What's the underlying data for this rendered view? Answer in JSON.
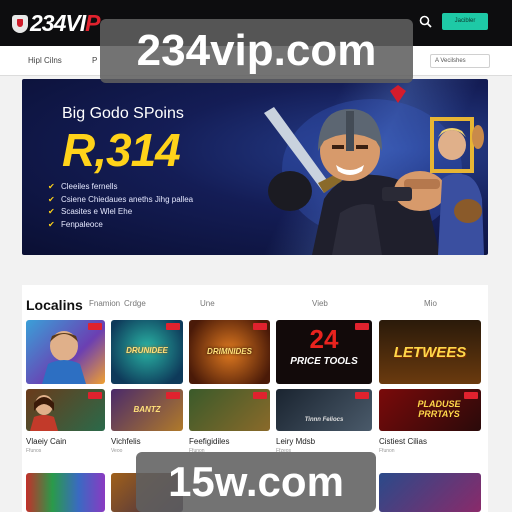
{
  "header": {
    "logo": {
      "prefix": "234VI",
      "accent": "P"
    },
    "signup_label": "Jacibler",
    "search_icon": "search-icon"
  },
  "nav": {
    "items": [
      "Hipl Cilns",
      "P"
    ],
    "right_pill": "A Vecilshes"
  },
  "banner": {
    "title": "Big Godo SPoins",
    "amount": "R,314",
    "bullets": [
      "Cleeiles fernells",
      "Csiene Chiedaues aneths Jihg pallea",
      "Scasites e Wlel Ehe",
      "Fenpaleoce"
    ]
  },
  "games": {
    "title": "Localins",
    "tabs": [
      "Fnamion",
      "Crdge",
      "Une",
      "Vieb",
      "Mio"
    ],
    "row1": [
      {
        "label": "",
        "name": "",
        "sub": ""
      },
      {
        "label": "DRUNIDEE",
        "name": "",
        "sub": ""
      },
      {
        "label": "DRIMNIDES",
        "name": "",
        "sub": ""
      },
      {
        "label": "PRICE TOOLS",
        "number": "24",
        "name": "",
        "sub": ""
      },
      {
        "label": "LETWEES",
        "name": "",
        "sub": ""
      }
    ],
    "row2": [
      {
        "label": "",
        "name": "Vlaeiy Cain",
        "sub": "Ffunos"
      },
      {
        "label": "BANTZ",
        "name": "Vichfelis",
        "sub": "Veoo"
      },
      {
        "label": "",
        "name": "Feefigidiles",
        "sub": "Ffunon"
      },
      {
        "label": "Tinnn Feliocs",
        "name": "Leiry Mdsb",
        "sub": "Ffzeos"
      },
      {
        "label": "PLADUSE PRRTAYS",
        "name": "Cistiest Cilias",
        "sub": "Ffunon"
      }
    ]
  },
  "watermarks": {
    "top": "234vip.com",
    "bottom": "15w.com"
  },
  "colors": {
    "header_bg": "#0d0d0f",
    "brand_red": "#e0222e",
    "cta_teal": "#1ec9a6",
    "banner_navy": "#141d56",
    "amount_yellow": "#ffd31a"
  }
}
